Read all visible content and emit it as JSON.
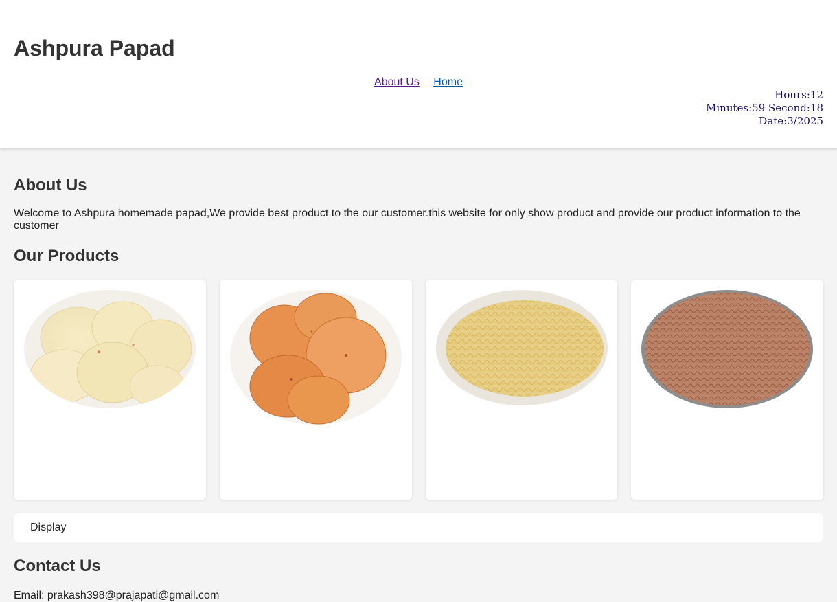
{
  "header": {
    "title": "Ashpura Papad",
    "nav": [
      {
        "label": "About Us"
      },
      {
        "label": "Home"
      }
    ],
    "clock": {
      "hours": "Hours:12",
      "minutes_seconds": "Minutes:59 Second:18",
      "date": "Date:3/2025"
    }
  },
  "about": {
    "title": "About Us",
    "text": "Welcome to Ashpura homemade papad,We provide best product to the our customer.this website for only show product and provide our product information to the customer"
  },
  "products": {
    "title": "Our Products",
    "items": [
      {
        "image": "white-papad-photo"
      },
      {
        "image": "masala-papad-photo"
      },
      {
        "image": "yellow-sev-photo"
      },
      {
        "image": "brown-sev-photo"
      }
    ]
  },
  "display": {
    "label": "Display"
  },
  "contact": {
    "title": "Contact Us",
    "email": "Email: prakash398@prajapati@gmail.com"
  },
  "colors": {
    "link": "#0b5bab",
    "visited_link": "#551a8b",
    "clock": "#1a1060",
    "background": "#f4f4f4"
  }
}
